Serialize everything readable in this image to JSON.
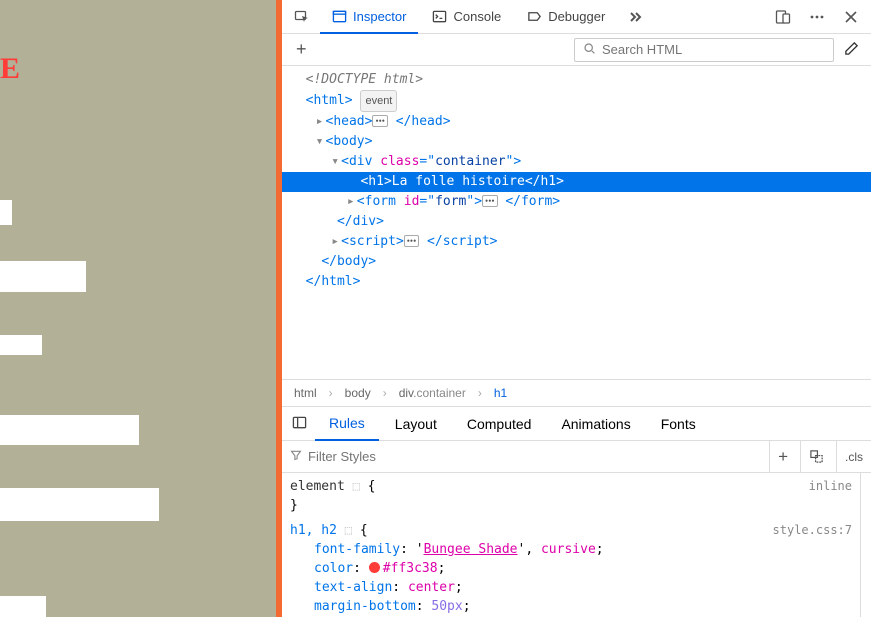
{
  "tabs": {
    "inspector": "Inspector",
    "console": "Console",
    "debugger": "Debugger"
  },
  "search": {
    "placeholder": "Search HTML"
  },
  "dom": {
    "doctype": "<!DOCTYPE html>",
    "html_open": "html",
    "event_badge": "event",
    "head": "head",
    "body": "body",
    "div_tag": "div",
    "div_class_attr": "class",
    "div_class_val": "container",
    "h1_tag": "h1",
    "h1_text": "La folle histoire",
    "form_tag": "form",
    "form_id_attr": "id",
    "form_id_val": "form",
    "script_tag": "script"
  },
  "breadcrumb": {
    "b0": "html",
    "b1": "body",
    "b2_tag": "div",
    "b2_cls": ".container",
    "b3": "h1"
  },
  "css_tabs": {
    "rules": "Rules",
    "layout": "Layout",
    "computed": "Computed",
    "animations": "Animations",
    "fonts": "Fonts"
  },
  "filter": {
    "placeholder": "Filter Styles"
  },
  "cls_label": ".cls",
  "rules": {
    "element_sel": "element",
    "inline": "inline",
    "h_sel": "h1, h2",
    "src": "style.css:7",
    "p1n": "font-family",
    "p1v1": "Bungee Shade",
    "p1v2": "cursive",
    "p2n": "color",
    "p2v": "#ff3c38",
    "p3n": "text-align",
    "p3v": "center",
    "p4n": "margin-bottom",
    "p4v": "50px"
  },
  "left_char": "E"
}
